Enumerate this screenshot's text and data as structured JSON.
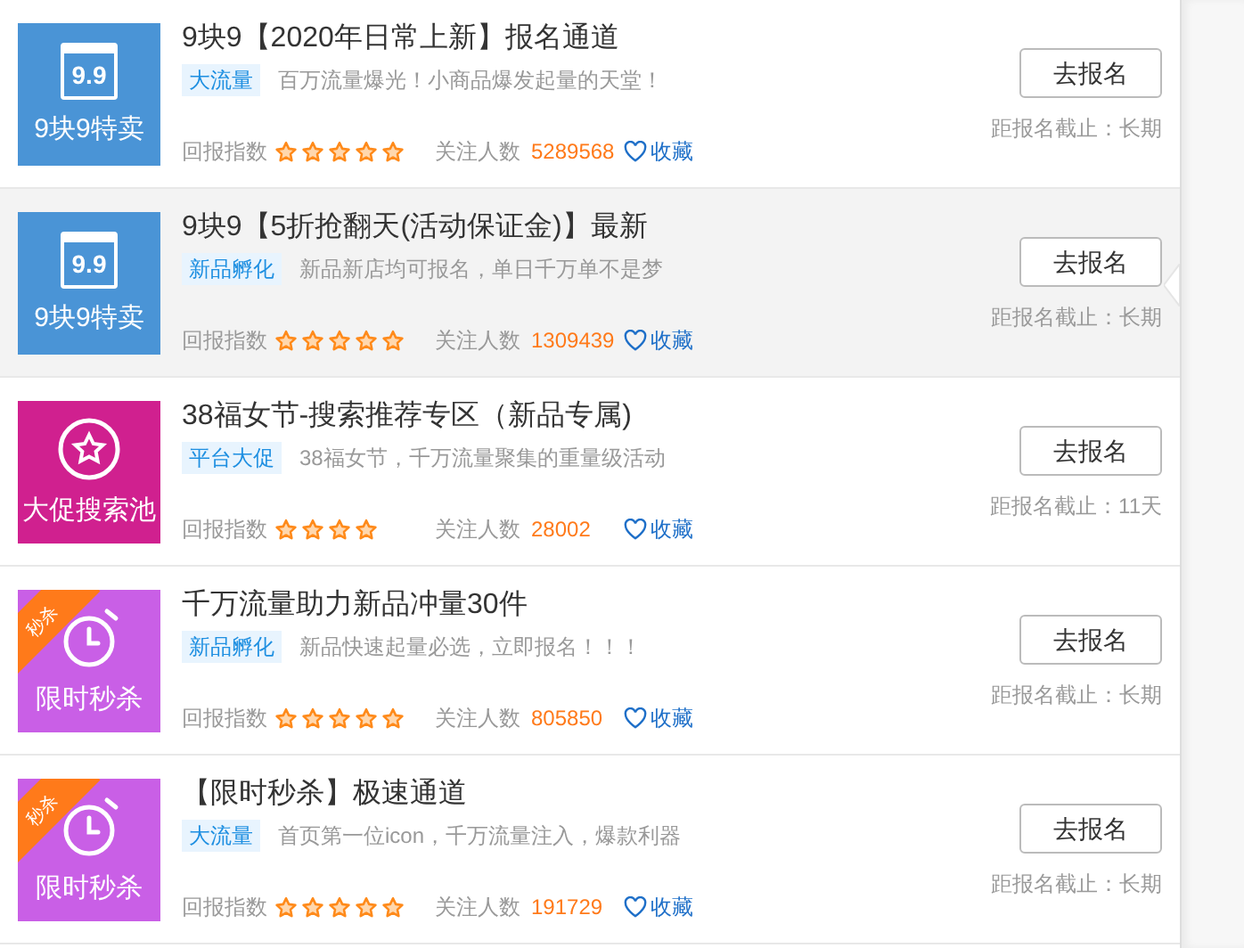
{
  "activities": [
    {
      "thumb": {
        "kind": "nine",
        "label": "9块9特卖",
        "icon_text": "9.9"
      },
      "title": "9块9【2020年日常上新】报名通道",
      "tag": "大流量",
      "description": "百万流量爆光！小商品爆发起量的天堂！",
      "rating_label": "回报指数",
      "stars": 5,
      "followers_label": "关注人数",
      "followers": "5289568",
      "favorite": "收藏",
      "button": "去报名",
      "deadline": "距报名截止：长期",
      "selected": false
    },
    {
      "thumb": {
        "kind": "nine",
        "label": "9块9特卖",
        "icon_text": "9.9"
      },
      "title": "9块9【5折抢翻天(活动保证金)】最新",
      "tag": "新品孵化",
      "description": "新品新店均可报名，单日千万单不是梦",
      "rating_label": "回报指数",
      "stars": 5,
      "followers_label": "关注人数",
      "followers": "1309439",
      "favorite": "收藏",
      "button": "去报名",
      "deadline": "距报名截止：长期",
      "selected": true
    },
    {
      "thumb": {
        "kind": "promo",
        "label": "大促搜索池"
      },
      "title": "38福女节-搜索推荐专区（新品专属)",
      "tag": "平台大促",
      "description": "38福女节，千万流量聚集的重量级活动",
      "rating_label": "回报指数",
      "stars": 4,
      "followers_label": "关注人数",
      "followers": "28002",
      "favorite": "收藏",
      "button": "去报名",
      "deadline": "距报名截止：11天",
      "selected": false
    },
    {
      "thumb": {
        "kind": "flash",
        "label": "限时秒杀",
        "ribbon": "秒杀"
      },
      "title": "千万流量助力新品冲量30件",
      "tag": "新品孵化",
      "description": "新品快速起量必选，立即报名！！！",
      "rating_label": "回报指数",
      "stars": 5,
      "followers_label": "关注人数",
      "followers": "805850",
      "favorite": "收藏",
      "button": "去报名",
      "deadline": "距报名截止：长期",
      "selected": false
    },
    {
      "thumb": {
        "kind": "flash",
        "label": "限时秒杀",
        "ribbon": "秒杀"
      },
      "title": "【限时秒杀】极速通道",
      "tag": "大流量",
      "description": "首页第一位icon，千万流量注入，爆款利器",
      "rating_label": "回报指数",
      "stars": 5,
      "followers_label": "关注人数",
      "followers": "191729",
      "favorite": "收藏",
      "button": "去报名",
      "deadline": "距报名截止：长期",
      "selected": false
    }
  ]
}
